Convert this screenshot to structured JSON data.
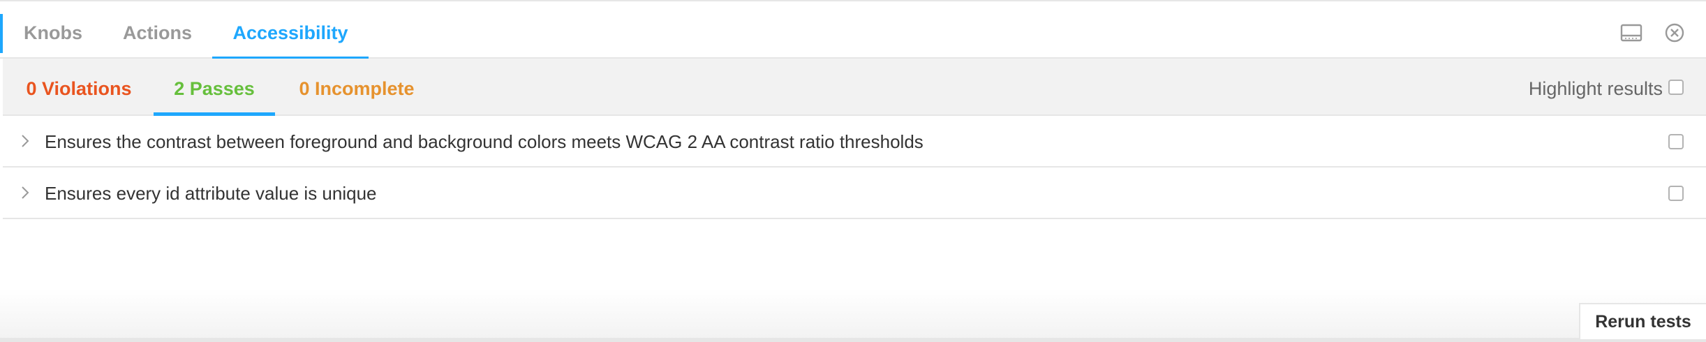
{
  "tabs": [
    {
      "label": "Knobs",
      "active": false
    },
    {
      "label": "Actions",
      "active": false
    },
    {
      "label": "Accessibility",
      "active": true
    }
  ],
  "toolbar_icons": [
    "panel-layout-icon",
    "close-icon"
  ],
  "subtabs": [
    {
      "label": "0 Violations",
      "color": "#e9541f"
    },
    {
      "label": "2 Passes",
      "color": "#66bf3c",
      "active": true
    },
    {
      "label": "0 Incomplete",
      "color": "#e6922e"
    }
  ],
  "highlight": {
    "label": "Highlight results",
    "checked": false
  },
  "results": [
    {
      "text": "Ensures the contrast between foreground and background colors meets WCAG 2 AA contrast ratio thresholds",
      "checked": false
    },
    {
      "text": "Ensures every id attribute value is unique",
      "checked": false
    }
  ],
  "rerun_label": "Rerun tests",
  "colors": {
    "accent": "#1ea7fd"
  }
}
